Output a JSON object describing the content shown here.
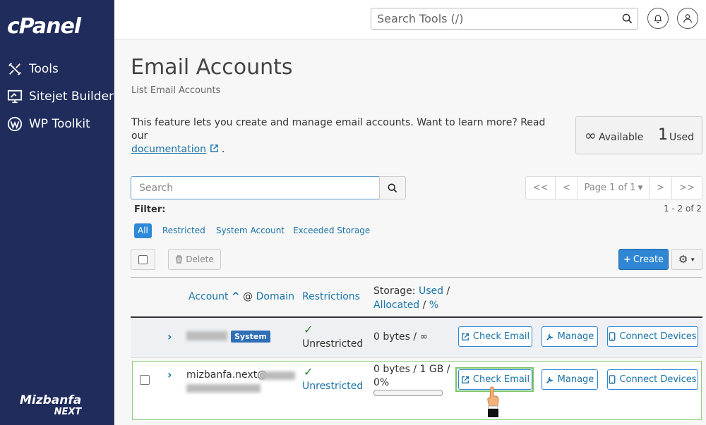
{
  "sidebar": {
    "logo": "cPanel",
    "items": [
      {
        "label": "Tools",
        "icon": "tools-icon"
      },
      {
        "label": "Sitejet Builder",
        "icon": "monitor-icon"
      },
      {
        "label": "WP Toolkit",
        "icon": "wordpress-icon"
      }
    ],
    "brand_line1": "Mizbanfa",
    "brand_line2": "NEXT"
  },
  "header": {
    "search_placeholder": "Search Tools (/)"
  },
  "page": {
    "title": "Email Accounts",
    "subtitle": "List Email Accounts",
    "description": "This feature lets you create and manage email accounts. Want to learn more? Read our",
    "doc_link": "documentation",
    "doc_suffix": "."
  },
  "stats": {
    "available_symbol": "∞",
    "available_label": "Available",
    "used_count": "1",
    "used_label": "Used"
  },
  "search": {
    "placeholder": "Search"
  },
  "pager": {
    "first": "<<",
    "prev": "<",
    "page": "Page 1 of 1",
    "next": ">",
    "last": ">>",
    "count": "1 - 2 of 2"
  },
  "filter": {
    "label": "Filter:",
    "options": [
      "All",
      "Restricted",
      "System Account",
      "Exceeded Storage"
    ],
    "active": "All"
  },
  "toolbar": {
    "delete": "Delete",
    "create": "Create"
  },
  "table": {
    "col_account": "Account",
    "col_at": "@",
    "col_domain": "Domain",
    "col_restrictions": "Restrictions",
    "col_storage_prefix": "Storage:",
    "col_storage_used": "Used",
    "col_storage_allocated": "Allocated",
    "col_storage_pct": "%",
    "rows": [
      {
        "account": "",
        "badge": "System",
        "restriction": "Unrestricted",
        "storage": "0 bytes / ∞"
      },
      {
        "account": "mizbanfa.next@",
        "restriction": "Unrestricted",
        "storage": "0 bytes / 1 GB /",
        "storage_pct": "0%",
        "storage_fill": 0
      }
    ],
    "actions": {
      "check_email": "Check Email",
      "manage": "Manage",
      "connect": "Connect Devices"
    }
  },
  "colors": {
    "sidebar": "#1f2c5c",
    "accent": "#2e86d4",
    "highlight": "#7dc56b",
    "success": "#2e7d32"
  }
}
